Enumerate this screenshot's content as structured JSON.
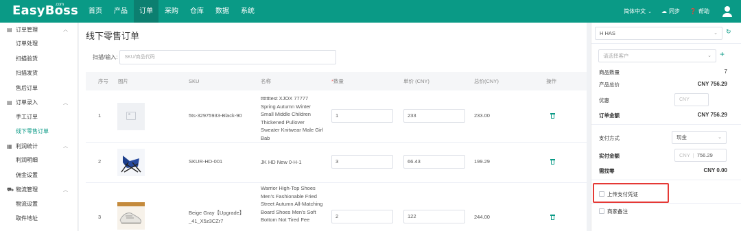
{
  "app": {
    "logo": "EasyBoss",
    "logo_sup": ".com"
  },
  "nav": [
    "首页",
    "产品",
    "订单",
    "采购",
    "仓库",
    "数据",
    "系统"
  ],
  "topbar_right": {
    "language": "简体中文",
    "language_caret": "⌄",
    "sync": "同步",
    "help": "帮助"
  },
  "sidebar": {
    "groups": [
      {
        "label": "订单管理",
        "icon": "order-doc-icon",
        "items": [
          "订单处理",
          "扫描验货",
          "扫描发货",
          "售后订单"
        ]
      },
      {
        "label": "订单录入",
        "icon": "order-entry-icon",
        "items": [
          "手工订单",
          "线下零售订单"
        ]
      },
      {
        "label": "利润统计",
        "icon": "profit-icon",
        "items": [
          "利润明细",
          "佣金设置"
        ]
      },
      {
        "label": "物流管理",
        "icon": "truck-icon",
        "items": [
          "物流设置",
          "取件地址"
        ]
      }
    ],
    "active_item": "线下零售订单"
  },
  "main": {
    "title": "线下零售订单",
    "scan_label": "扫描/输入:",
    "scan_placeholder": "SKU/商品代码",
    "table": {
      "headers": {
        "index": "序号",
        "image": "图片",
        "sku": "SKU",
        "name": "名称",
        "qty_required_mark": "*",
        "qty": "数量",
        "price": "单价 (CNY)",
        "total": "总价(CNY)",
        "action": "操作"
      },
      "rows": [
        {
          "index": "1",
          "sku": "5ts-32975933-Black-90",
          "name": "tttttttest XJOX 77777 Spring Autumn Winter Small Middle Children Thickened Pullover Sweater Knitwear Male Girl Bab",
          "qty": "1",
          "price": "233",
          "total": "233.00"
        },
        {
          "index": "2",
          "sku": "SKUR-HD-001",
          "name": "JK HD New 0-H-1",
          "qty": "3",
          "price": "66.43",
          "total": "199.29"
        },
        {
          "index": "3",
          "sku": "Beige Gray【Upgrade】_41_X5z3CZr7",
          "name": "Warrior High-Top Shoes Men's Fashionable Fried Street Autumn All-Matching Board Shoes Men's Soft Bottom Not Tired Fee",
          "qty": "2",
          "price": "122",
          "total": "244.00"
        }
      ]
    }
  },
  "right_panel": {
    "store_select": "H HAS",
    "customer_placeholder": "请选择客户",
    "add_customer": "+",
    "product_qty_label": "商品数量",
    "product_qty_value": "7",
    "product_total_label": "产品总价",
    "product_total_value": "CNY 756.29",
    "discount_label": "优惠",
    "discount_placeholder": "CNY",
    "order_amount_label": "订单金额",
    "order_amount_value": "CNY 756.29",
    "payment_method_label": "支付方式",
    "payment_method_value": "现金",
    "paid_amount_label": "实付金额",
    "paid_amount_prefix": "CNY",
    "paid_amount_value": "756.29",
    "change_label": "需找零",
    "change_value": "CNY 0.00",
    "upload_voucher_label": "上传支付凭证",
    "merchant_note_label": "商家备注"
  },
  "colors": {
    "brand": "#0a9a86",
    "highlight_box": "#e53935"
  }
}
